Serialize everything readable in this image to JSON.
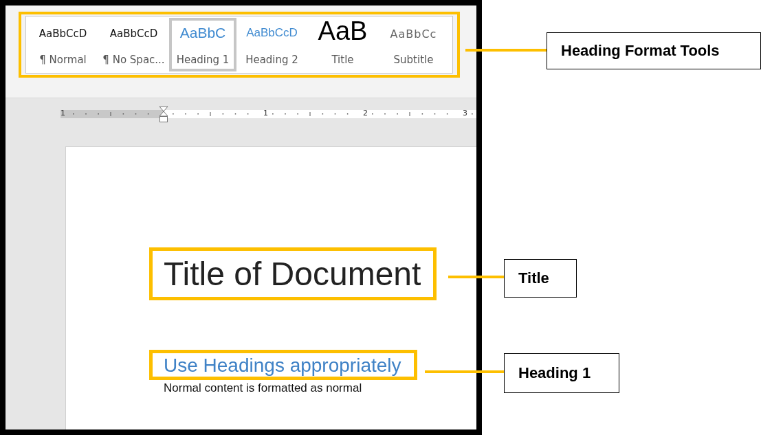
{
  "styles_gallery": {
    "styles": [
      {
        "sample": "AaBbCcD",
        "name": "¶ Normal",
        "kind": "normal",
        "selected": false
      },
      {
        "sample": "AaBbCcD",
        "name": "¶ No Spac...",
        "kind": "nospacing",
        "selected": false
      },
      {
        "sample": "AaBbC",
        "name": "Heading 1",
        "kind": "heading1",
        "selected": true
      },
      {
        "sample": "AaBbCcD",
        "name": "Heading 2",
        "kind": "heading2",
        "selected": false
      },
      {
        "sample": "AaB",
        "name": "Title",
        "kind": "title",
        "selected": false
      },
      {
        "sample": "AaBbCc",
        "name": "Subtitle",
        "kind": "subtitle",
        "selected": false
      }
    ]
  },
  "ruler": {
    "labels": [
      "1",
      "1",
      "2",
      "3"
    ]
  },
  "document": {
    "title": "Title of Document",
    "heading": "Use Headings appropriately",
    "body": "Normal content is formatted as normal"
  },
  "callouts": [
    {
      "label": "Heading Format Tools"
    },
    {
      "label": "Title"
    },
    {
      "label": "Heading 1"
    }
  ]
}
